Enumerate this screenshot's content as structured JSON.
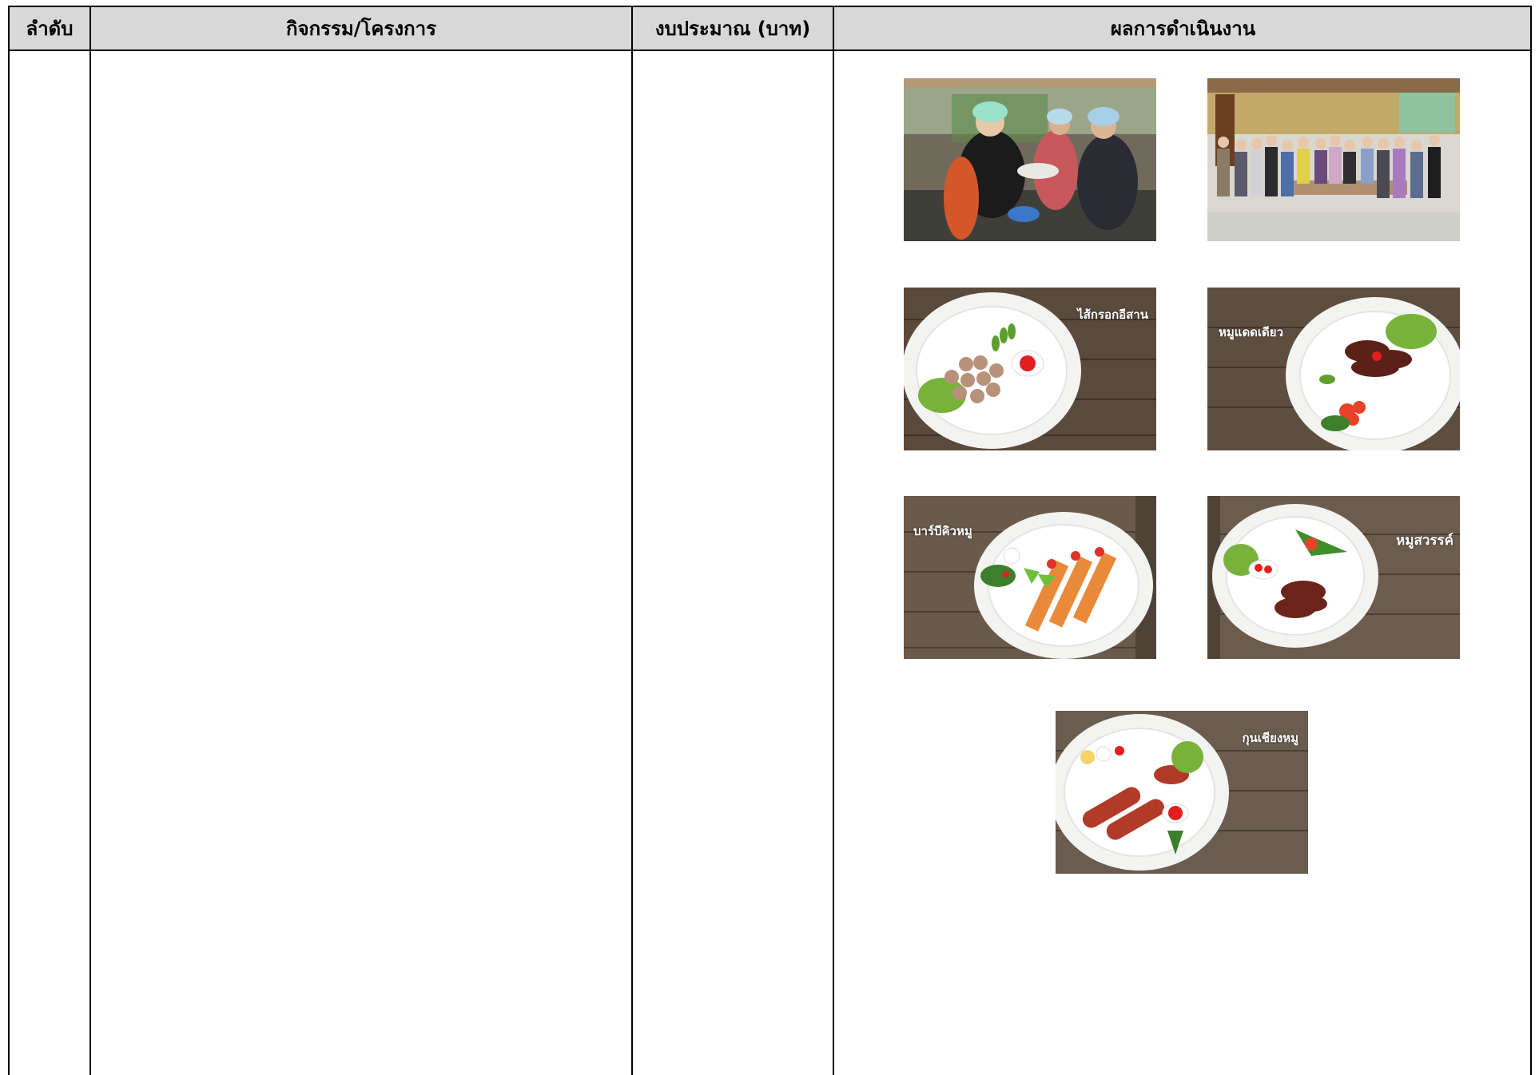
{
  "table": {
    "headers": {
      "order": "ลำดับ",
      "activity": "กิจกรรม/โครงการ",
      "budget": "งบประมาณ (บาท)",
      "result": "ผลการดำเนินงาน"
    }
  },
  "photos": {
    "dish_captions": [
      "ไส้กรอกอีสาน",
      "หมูแดดเดียว",
      "บาร์บีคิวหมู",
      "หมูสวรรค์",
      "กุนเชียงหมู"
    ]
  }
}
